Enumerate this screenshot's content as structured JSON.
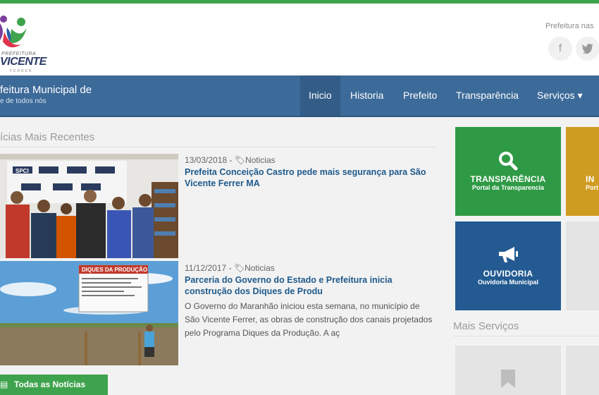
{
  "header": {
    "logo": {
      "small_text": "PREFEITURA",
      "name": "VICENTE",
      "sub": "FERRER"
    },
    "right_label": "Prefeitura nas",
    "social": [
      {
        "icon": "facebook-icon",
        "glyph": "f"
      },
      {
        "icon": "twitter-icon",
        "glyph": "🐦"
      }
    ]
  },
  "navbar": {
    "site_title": "feitura Municipal de",
    "site_sub": "e de todos nós",
    "items": [
      {
        "label": "Inicio",
        "active": true
      },
      {
        "label": "Historia",
        "active": false
      },
      {
        "label": "Prefeito",
        "active": false
      },
      {
        "label": "Transparência",
        "active": false
      },
      {
        "label": "Serviços ▾",
        "active": false
      }
    ]
  },
  "news": {
    "section_title": "ícias Mais Recentes",
    "items": [
      {
        "date": "13/03/2018 - ",
        "category": "Noticias",
        "title": "Prefeita Conceição Castro pede mais segurança para São Vicente Ferrer MA",
        "excerpt": ""
      },
      {
        "date": "11/12/2017 - ",
        "category": "Noticias",
        "title": "Parceria do Governo do Estado e Prefeitura inicia construção dos Diques de Produ",
        "excerpt": "O Governo do Maranhão iniciou esta semana, no município de São Vicente Ferrer, as obras de construção dos canais projetados pelo Programa Diques da Produção. A aç"
      }
    ],
    "banner_text": "SPCI",
    "sign_title": "DIQUES DA PRODUÇÃO",
    "all_button": "Todas as Notícias"
  },
  "tiles": [
    {
      "title": "TRANSPARÊNCIA",
      "subtitle": "Portal da Transparencia",
      "color": "#2f9a45",
      "icon": "search-icon"
    },
    {
      "title": "IN",
      "subtitle": "Port",
      "color": "#cf9c22",
      "icon": "info-icon"
    },
    {
      "title": "OUVIDORIA",
      "subtitle": "Ouvidoria Municipal",
      "color": "#235a91",
      "icon": "megaphone-icon"
    }
  ],
  "more_services": {
    "title": "Mais Serviços"
  },
  "colors": {
    "green": "#3fa34d",
    "nav_blue": "#3c6a99",
    "link_blue": "#1f5a8c"
  }
}
